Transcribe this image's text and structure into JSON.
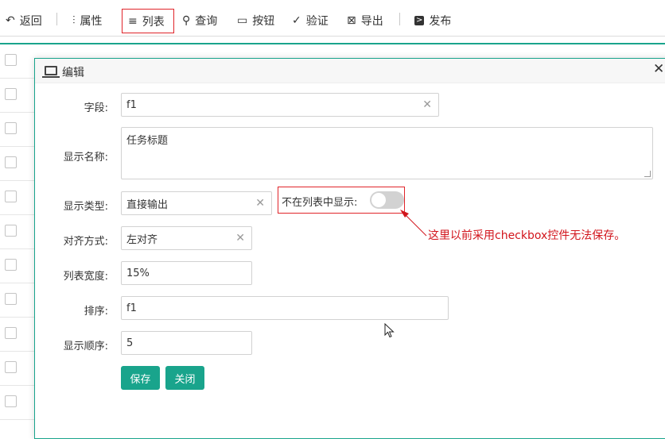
{
  "toolbar": {
    "back": "返回",
    "attributes": "属性",
    "list": "列表",
    "query": "查询",
    "buttons": "按钮",
    "validate": "验证",
    "export": "导出",
    "publish": "发布"
  },
  "dialog": {
    "title": "编辑",
    "field_label": "字段:",
    "field_value": "f1",
    "display_name_label": "显示名称:",
    "display_name_value": "任务标题",
    "display_type_label": "显示类型:",
    "display_type_value": "直接输出",
    "hide_in_list_label": "不在列表中显示:",
    "align_label": "对齐方式:",
    "align_value": "左对齐",
    "width_label": "列表宽度:",
    "width_value": "15%",
    "sort_label": "排序:",
    "sort_value": "f1",
    "order_label": "显示顺序:",
    "order_value": "5",
    "save": "保存",
    "close": "关闭"
  },
  "annotation": "这里以前采用checkbox控件无法保存。",
  "colors": {
    "accent": "#19a48c",
    "highlight": "#e0242a",
    "annotation": "#d2151c"
  }
}
